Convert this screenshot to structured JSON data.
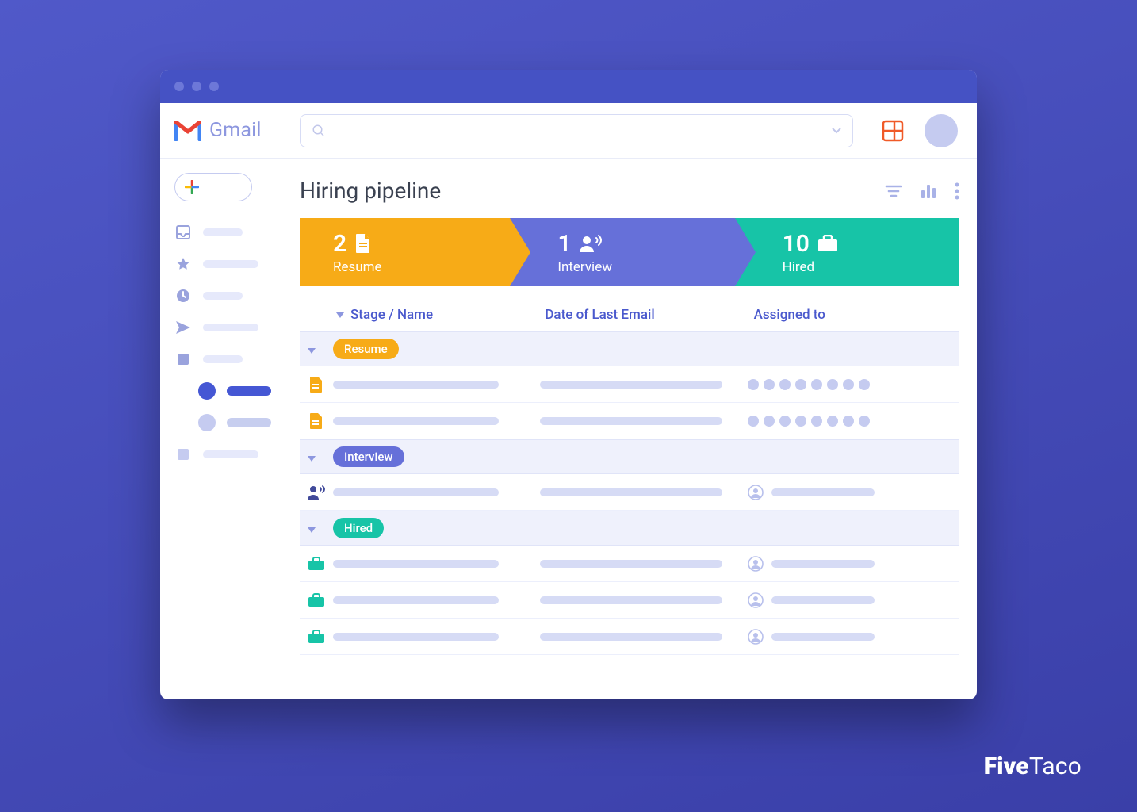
{
  "header": {
    "app_name": "Gmail",
    "search_placeholder": ""
  },
  "sidebar": {
    "compose_icon": "plus-icon"
  },
  "main": {
    "title": "Hiring pipeline"
  },
  "pipeline": {
    "stages": [
      {
        "key": "resume",
        "count": "2",
        "label": "Resume",
        "color": "#f7ab17"
      },
      {
        "key": "interview",
        "count": "1",
        "label": "Interview",
        "color": "#6670d9"
      },
      {
        "key": "hired",
        "count": "10",
        "label": "Hired",
        "color": "#17c4a7"
      }
    ]
  },
  "table": {
    "columns": [
      "Stage / Name",
      "Date of Last Email",
      "Assigned to"
    ],
    "groups": [
      {
        "key": "resume",
        "label": "Resume",
        "rows": [
          "dots8",
          "dots8"
        ]
      },
      {
        "key": "interview",
        "label": "Interview",
        "rows": [
          "avatar"
        ]
      },
      {
        "key": "hired",
        "label": "Hired",
        "rows": [
          "avatar",
          "avatar",
          "avatar"
        ]
      }
    ]
  },
  "watermark": {
    "bold": "Five",
    "light": "Taco"
  }
}
